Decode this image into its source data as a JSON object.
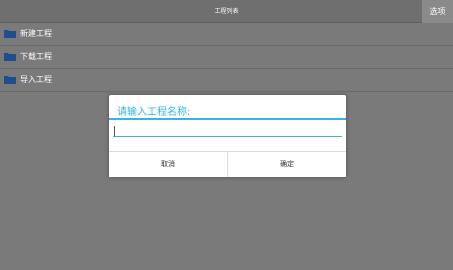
{
  "titlebar": {
    "title": "工程列表",
    "options_label": "选项"
  },
  "projects": [
    {
      "label": "新建工程",
      "icon": "folder-icon"
    },
    {
      "label": "下载工程",
      "icon": "folder-icon"
    },
    {
      "label": "导入工程",
      "icon": "folder-icon"
    }
  ],
  "dialog": {
    "title": "请输入工程名称:",
    "input_value": "",
    "cancel_label": "取消",
    "confirm_label": "确定"
  },
  "colors": {
    "accent": "#33b5e5",
    "folder": "#1f4e8c",
    "overlay": "#7a7a7a"
  }
}
